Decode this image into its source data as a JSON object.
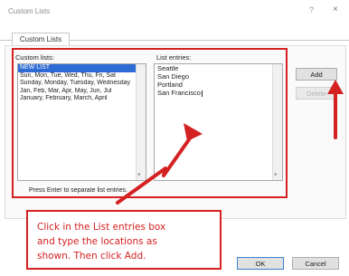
{
  "window": {
    "title": "Custom Lists",
    "help_glyph": "?",
    "close_glyph": "×"
  },
  "tabs": [
    {
      "label": "Custom Lists",
      "active": true
    }
  ],
  "custom_lists": {
    "label": "Custom lists:",
    "items": [
      {
        "text": "NEW LIST",
        "selected": true
      },
      {
        "text": "Sun, Mon, Tue, Wed, Thu, Fri, Sat",
        "selected": false
      },
      {
        "text": "Sunday, Monday, Tuesday, Wednesday",
        "selected": false
      },
      {
        "text": "Jan, Feb, Mar, Apr, May, Jun, Jul",
        "selected": false
      },
      {
        "text": "January, February, March, April",
        "selected": false
      }
    ]
  },
  "list_entries": {
    "label": "List entries:",
    "entries": [
      "Seattle",
      "San Diego",
      "Portland",
      "San Francisco"
    ]
  },
  "hint": "Press Enter to separate list entries.",
  "buttons": {
    "add": "Add",
    "delete": "Delete",
    "ok": "OK",
    "cancel": "Cancel"
  },
  "callout": {
    "lines": [
      "Click in the List entries box",
      "and type the locations as",
      "shown. Then click Add."
    ]
  },
  "colors": {
    "annotation_red": "#d42121",
    "selection_blue": "#2e6bd4"
  }
}
